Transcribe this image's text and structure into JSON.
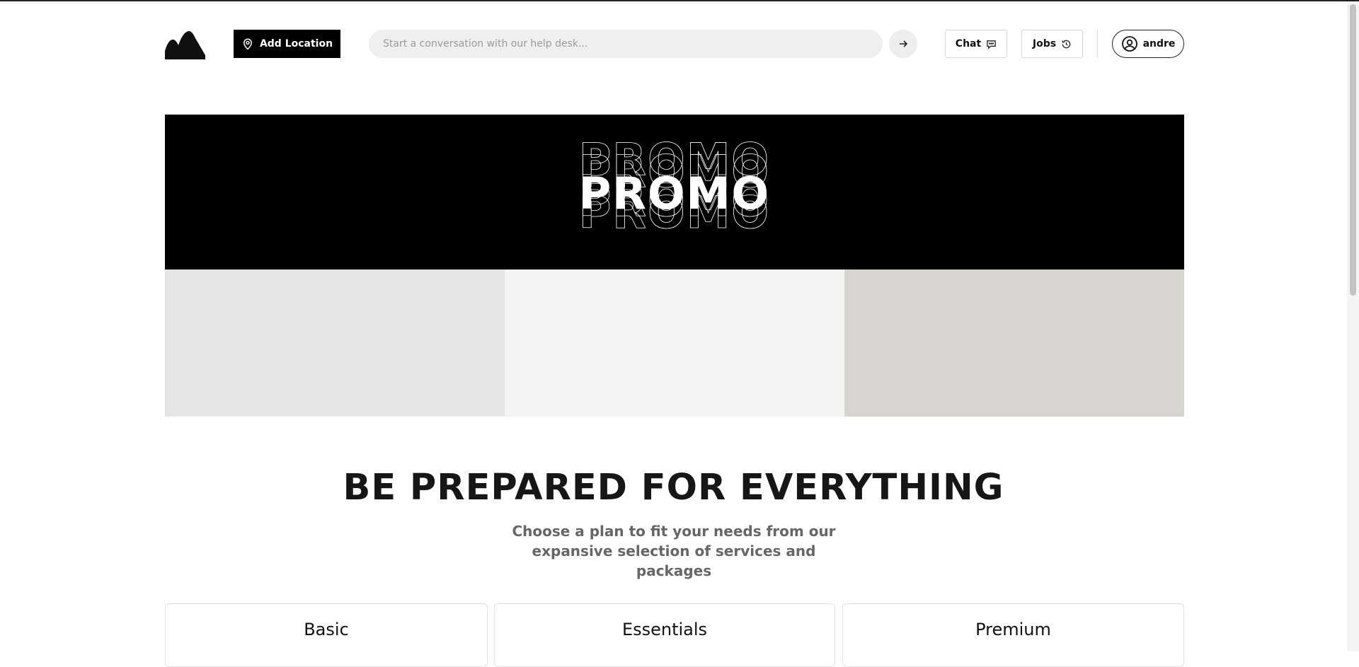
{
  "header": {
    "logo_icon": "mountain-logo-icon",
    "add_location_label": "Add Location",
    "add_location_icon": "map-pin-icon",
    "search_placeholder": "Start a conversation with our help desk...",
    "send_icon": "arrow-right-icon",
    "chat_label": "Chat",
    "chat_icon": "chat-bubble-icon",
    "jobs_label": "Jobs",
    "jobs_icon": "history-icon",
    "user_name": "andre",
    "user_icon": "user-circle-icon"
  },
  "promo": {
    "text": "PROMO"
  },
  "hero": {
    "title": "BE PREPARED FOR EVERYTHING",
    "subtitle": "Choose a plan to fit your needs from our expansive selection of services and packages"
  },
  "plans": [
    {
      "name": "Basic"
    },
    {
      "name": "Essentials"
    },
    {
      "name": "Premium"
    }
  ],
  "colors": {
    "accent": "#000000",
    "tile_1": "#e7e6e4",
    "tile_2": "#f4f4f2",
    "tile_3": "#d8d5d1"
  }
}
